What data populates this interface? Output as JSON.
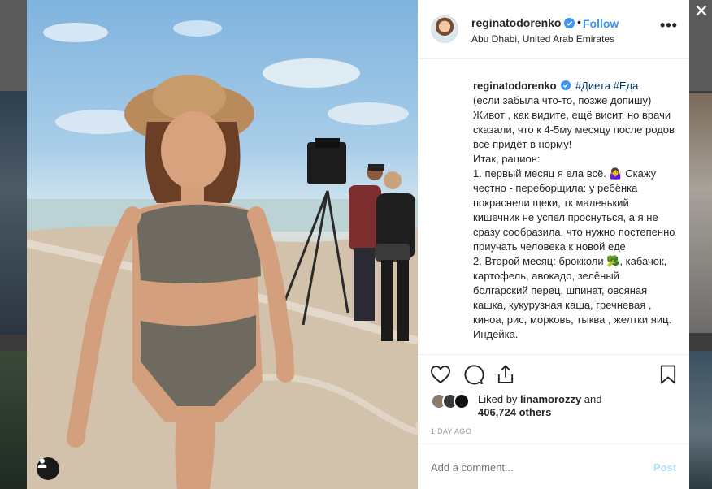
{
  "post": {
    "username": "reginatodorenko",
    "follow_label": "Follow",
    "separator": "•",
    "location": "Abu Dhabi, United Arab Emirates",
    "more_label": "•••"
  },
  "caption": {
    "username": "reginatodorenko",
    "hashtags": [
      "#Диета",
      "#Еда"
    ],
    "lines": [
      "(если забыла что-то, позже допишу)",
      "Живот , как видите, ещё висит, но врачи сказали, что к 4-5му месяцу после родов все придёт в норму!",
      "Итак, рацион:",
      "1. первый месяц я ела всё. 🤷‍♀️ Скажу честно - переборщила: у ребёнка покраснели щеки, тк маленький кишечник не успел проснуться, а я не сразу сообразила, что нужно постепенно приучать человека к новой еде",
      "2. Второй месяц: брокколи 🥦, кабачок, картофель, авокадо, зелёный болгарский перец, шпинат, овсяная кашка, кукурузная каша, гречневая , киноа, рис, морковь, тыква , желтки яиц. Индейка."
    ]
  },
  "likes": {
    "liked_by_prefix": "Liked by",
    "liked_by_user": "linamorozzy",
    "and_label": "and",
    "others": "406,724 others"
  },
  "time": "1 DAY AGO",
  "comment": {
    "placeholder": "Add a comment...",
    "post_label": "Post"
  },
  "colors": {
    "link_blue": "#3897f0",
    "hashtag_blue": "#003569",
    "muted": "#999999",
    "post_disabled": "#b2dffc"
  },
  "icons": {
    "close": "close-icon",
    "verified": "verified-badge-icon",
    "heart": "heart-icon",
    "comment": "comment-icon",
    "share": "share-icon",
    "save": "bookmark-icon",
    "tag": "user-tag-icon"
  }
}
